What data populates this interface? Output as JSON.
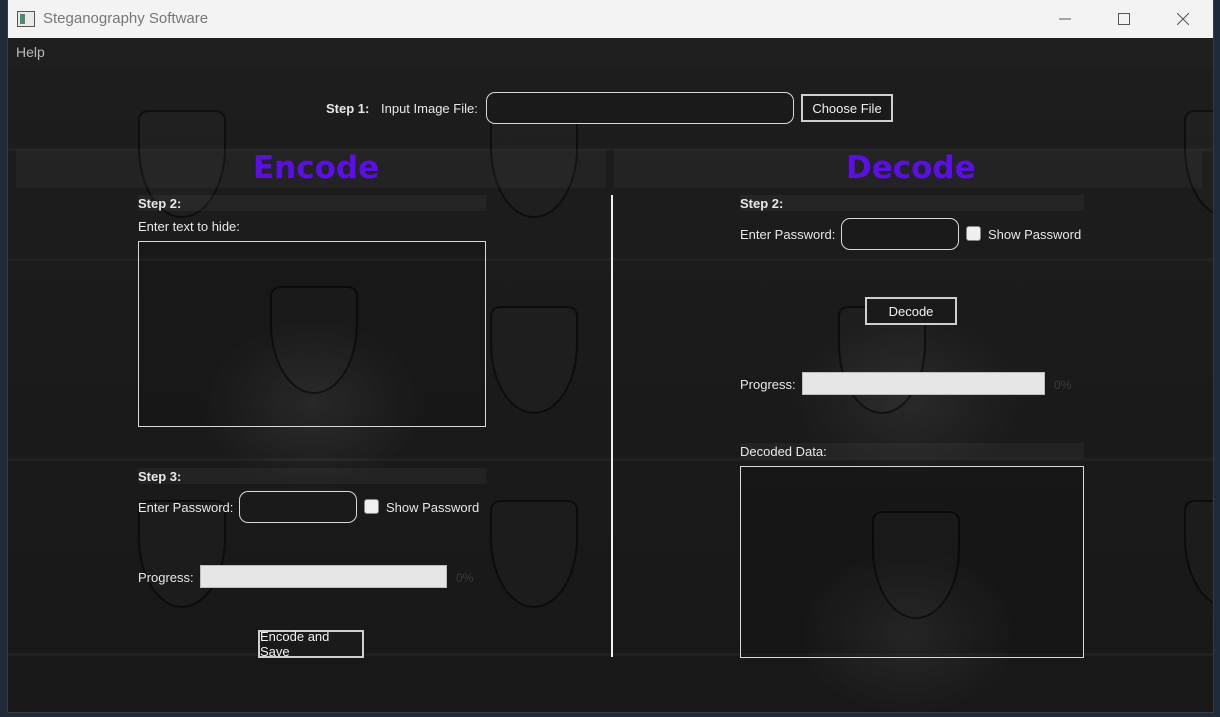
{
  "window": {
    "title": "Steganography Software",
    "controls": {
      "minimize": "—",
      "maximize": "☐",
      "close": "✕"
    }
  },
  "menu": {
    "help": "Help"
  },
  "step1": {
    "label_bold": "Step 1:",
    "label": "Input Image File:",
    "input_value": "",
    "choose_button": "Choose File"
  },
  "encode": {
    "heading": "Encode",
    "step2": "Step 2:",
    "enter_text_label": "Enter text to hide:",
    "text_value": "",
    "step3": "Step 3:",
    "password_label": "Enter Password:",
    "password_value": "",
    "show_password_label": "Show Password",
    "show_password_checked": false,
    "progress_label": "Progress:",
    "progress_value": 0,
    "progress_text": "0%",
    "encode_button": "Encode and Save"
  },
  "decode": {
    "heading": "Decode",
    "step2": "Step 2:",
    "password_label": "Enter Password:",
    "password_value": "",
    "show_password_label": "Show Password",
    "show_password_checked": false,
    "decode_button": "Decode",
    "progress_label": "Progress:",
    "progress_value": 0,
    "progress_text": "0%",
    "decoded_data_label": "Decoded Data:",
    "decoded_value": ""
  },
  "colors": {
    "heading": "#5b0fe6",
    "background": "#1b1b1b"
  },
  "icons": {
    "app": "app-window-icon",
    "background_motif": "shield-icon"
  }
}
